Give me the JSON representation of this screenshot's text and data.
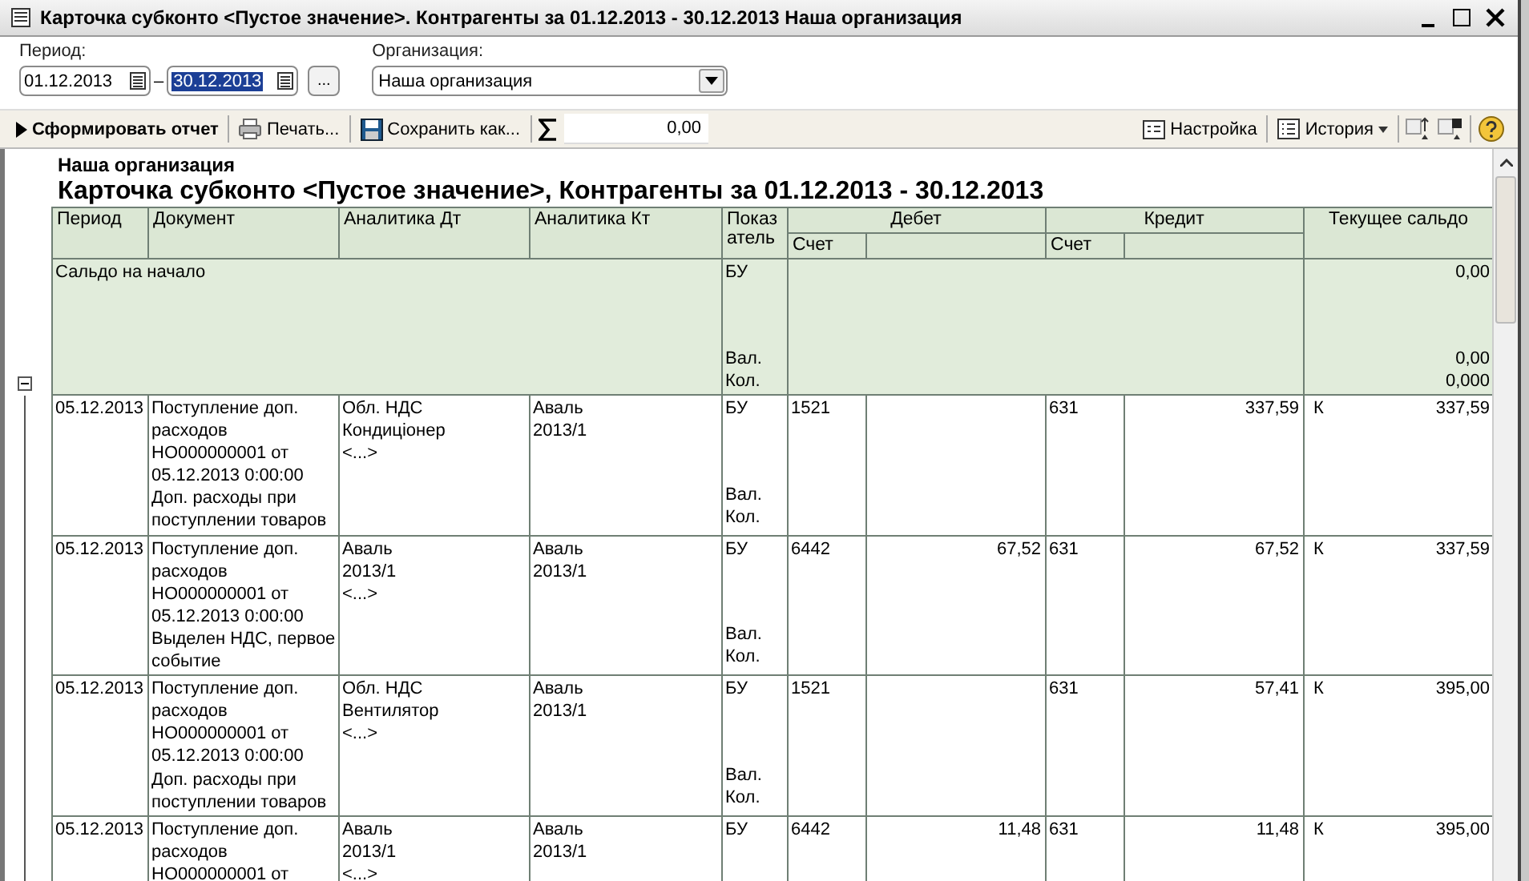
{
  "window": {
    "title": "Карточка субконто <Пустое значение>. Контрагенты за 01.12.2013 - 30.12.2013 Наша организация"
  },
  "form": {
    "period_label": "Период:",
    "date_from": "01.12.2013",
    "date_separator": "–",
    "date_to": "30.12.2013",
    "date_to_selected": true,
    "period_button": "...",
    "organization_label": "Организация:",
    "organization": "Наша организация"
  },
  "toolbar": {
    "generate": "Сформировать отчет",
    "print": "Печать...",
    "save_as": "Сохранить как...",
    "sum_value": "0,00",
    "settings": "Настройка",
    "history": "История"
  },
  "report": {
    "organization": "Наша организация",
    "title": "Карточка субконто <Пустое значение>, Контрагенты за 01.12.2013 - 30.12.2013",
    "columns": {
      "period": "Период",
      "document": "Документ",
      "analytics_dt": "Аналитика Дт",
      "analytics_kt": "Аналитика Кт",
      "indicator": "Показ\nатель",
      "debit": "Дебет",
      "debit_account": "Счет",
      "credit": "Кредит",
      "credit_account": "Счет",
      "balance": "Текущее сальдо"
    },
    "opening": {
      "label": "Сальдо на начало",
      "expanded": true,
      "indicators": [
        "БУ",
        "Вал.",
        "Кол."
      ],
      "balances": [
        "0,00",
        "0,00",
        "0,000"
      ]
    },
    "rows": [
      {
        "period": "05.12.2013",
        "document": "Поступление доп.\nрасходов\nНО000000001 от\n05.12.2013 0:00:00\nДоп. расходы при\nпоступлении товаров",
        "analytics_dt": "Обл. НДС\nКондиціонер\n<...>",
        "analytics_kt": "Аваль\n2013/1",
        "indicators": [
          "БУ",
          "Вал.",
          "Кол."
        ],
        "debit_account": "1521",
        "debit_amount": "",
        "credit_account": "631",
        "credit_amount": "337,59",
        "balance_side": "К",
        "balance": "337,59"
      },
      {
        "period": "05.12.2013",
        "document": "Поступление доп.\nрасходов\nНО000000001 от\n05.12.2013 0:00:00\nВыделен НДС, первое\nсобытие",
        "analytics_dt": "Аваль\n2013/1\n<...>",
        "analytics_kt": "Аваль\n2013/1",
        "indicators": [
          "БУ",
          "Вал.",
          "Кол."
        ],
        "debit_account": "6442",
        "debit_amount": "67,52",
        "credit_account": "631",
        "credit_amount": "67,52",
        "balance_side": "К",
        "balance": "337,59"
      },
      {
        "period": "05.12.2013",
        "document": "Поступление доп.\nрасходов\nНО000000001 от\n05.12.2013 0:00:00\nДоп. расходы при\nпоступлении товаров",
        "analytics_dt": "Обл. НДС\nВентилятор\n<...>",
        "analytics_kt": "Аваль\n2013/1",
        "indicators": [
          "БУ",
          "Вал.",
          "Кол."
        ],
        "debit_account": "1521",
        "debit_amount": "",
        "credit_account": "631",
        "credit_amount": "57,41",
        "balance_side": "К",
        "balance": "395,00"
      },
      {
        "period": "05.12.2013",
        "document": "Поступление доп.\nрасходов\nНО000000001 от",
        "analytics_dt": "Аваль\n2013/1\n<...>",
        "analytics_kt": "Аваль\n2013/1",
        "indicators": [
          "БУ"
        ],
        "debit_account": "6442",
        "debit_amount": "11,48",
        "credit_account": "631",
        "credit_amount": "11,48",
        "balance_side": "К",
        "balance": "395,00"
      }
    ]
  }
}
